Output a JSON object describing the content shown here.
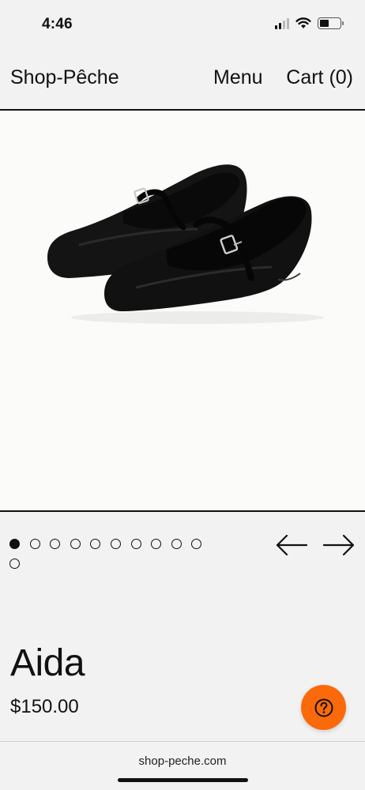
{
  "status_bar": {
    "time": "4:46",
    "icons": [
      "cellular-signal-icon",
      "wifi-icon",
      "battery-icon"
    ]
  },
  "header": {
    "logo": "Shop-Pêche",
    "menu_label": "Menu",
    "cart_label": "Cart (0)"
  },
  "gallery": {
    "image_subject": "black satin mary-jane ballet flats",
    "total_images": 11,
    "active_index": 0,
    "prev_icon": "arrow-left-icon",
    "next_icon": "arrow-right-icon"
  },
  "product": {
    "name": "Aida",
    "price": "$150.00"
  },
  "help": {
    "icon": "question-mark-icon",
    "color": "#fa6a0a"
  },
  "browser": {
    "url": "shop-peche.com"
  }
}
